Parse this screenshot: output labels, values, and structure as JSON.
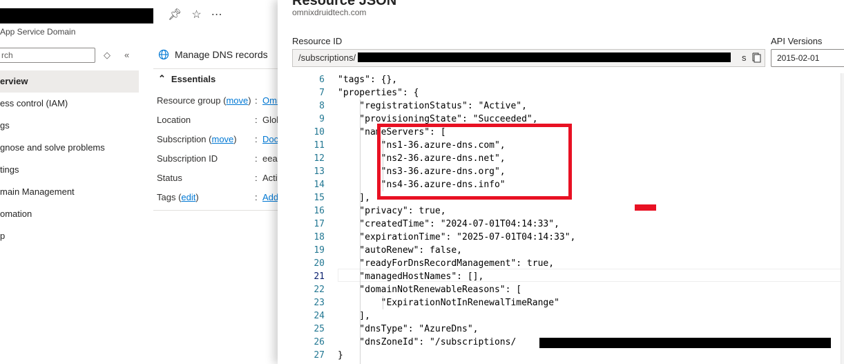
{
  "blade": {
    "subtitle": "App Service Domain",
    "search_placeholder": "rch",
    "nav_items": [
      {
        "label": "erview"
      },
      {
        "label": "ess control (IAM)"
      },
      {
        "label": "gs"
      },
      {
        "label": "gnose and solve problems"
      },
      {
        "label": "tings"
      },
      {
        "label": "main Management"
      },
      {
        "label": "omation"
      },
      {
        "label": "p"
      }
    ],
    "toolbar_label": "Manage DNS records",
    "essentials_label": "Essentials",
    "essentials": [
      {
        "label": "Resource group",
        "link": "move",
        "value": "Omn"
      },
      {
        "label": "Location",
        "value": "Glob"
      },
      {
        "label": "Subscription",
        "link": "move",
        "value": "Doc"
      },
      {
        "label": "Subscription ID",
        "value": "eeaa"
      },
      {
        "label": "Status",
        "value": "Activ"
      },
      {
        "label": "Tags",
        "link": "edit",
        "value": "Add"
      }
    ]
  },
  "panel": {
    "title": "Resource JSON",
    "subtitle": "omnixdruidtech.com",
    "resource_id_label": "Resource ID",
    "resource_id_prefix": "/subscriptions/",
    "resource_id_tail": "s",
    "api_versions_label": "API Versions",
    "api_version": "2015-02-01"
  },
  "editor": {
    "current_line": 21,
    "lines": [
      {
        "n": "6",
        "text": "\"tags\": {},"
      },
      {
        "n": "7",
        "text": "\"properties\": {"
      },
      {
        "n": "8",
        "text": "    \"registrationStatus\": \"Active\","
      },
      {
        "n": "9",
        "text": "    \"provisioningState\": \"Succeeded\","
      },
      {
        "n": "10",
        "text": "    \"nameServers\": ["
      },
      {
        "n": "11",
        "text": "        \"ns1-36.azure-dns.com\","
      },
      {
        "n": "12",
        "text": "        \"ns2-36.azure-dns.net\","
      },
      {
        "n": "13",
        "text": "        \"ns3-36.azure-dns.org\","
      },
      {
        "n": "14",
        "text": "        \"ns4-36.azure-dns.info\""
      },
      {
        "n": "15",
        "text": "    ],"
      },
      {
        "n": "16",
        "text": "    \"privacy\": true,"
      },
      {
        "n": "17",
        "text": "    \"createdTime\": \"2024-07-01T04:14:33\","
      },
      {
        "n": "18",
        "text": "    \"expirationTime\": \"2025-07-01T04:14:33\","
      },
      {
        "n": "19",
        "text": "    \"autoRenew\": false,"
      },
      {
        "n": "20",
        "text": "    \"readyForDnsRecordManagement\": true,"
      },
      {
        "n": "21",
        "text": "    \"managedHostNames\": [],"
      },
      {
        "n": "22",
        "text": "    \"domainNotRenewableReasons\": ["
      },
      {
        "n": "23",
        "text": "        \"ExpirationNotInRenewalTimeRange\""
      },
      {
        "n": "24",
        "text": "    ],"
      },
      {
        "n": "25",
        "text": "    \"dnsType\": \"AzureDns\","
      },
      {
        "n": "26",
        "text": "    \"dnsZoneId\": \"/subscriptions/"
      },
      {
        "n": "27",
        "text": "}"
      }
    ]
  },
  "colors": {
    "accent": "#0078d4",
    "annotation_red": "#e81123",
    "line_number": "#237893"
  }
}
